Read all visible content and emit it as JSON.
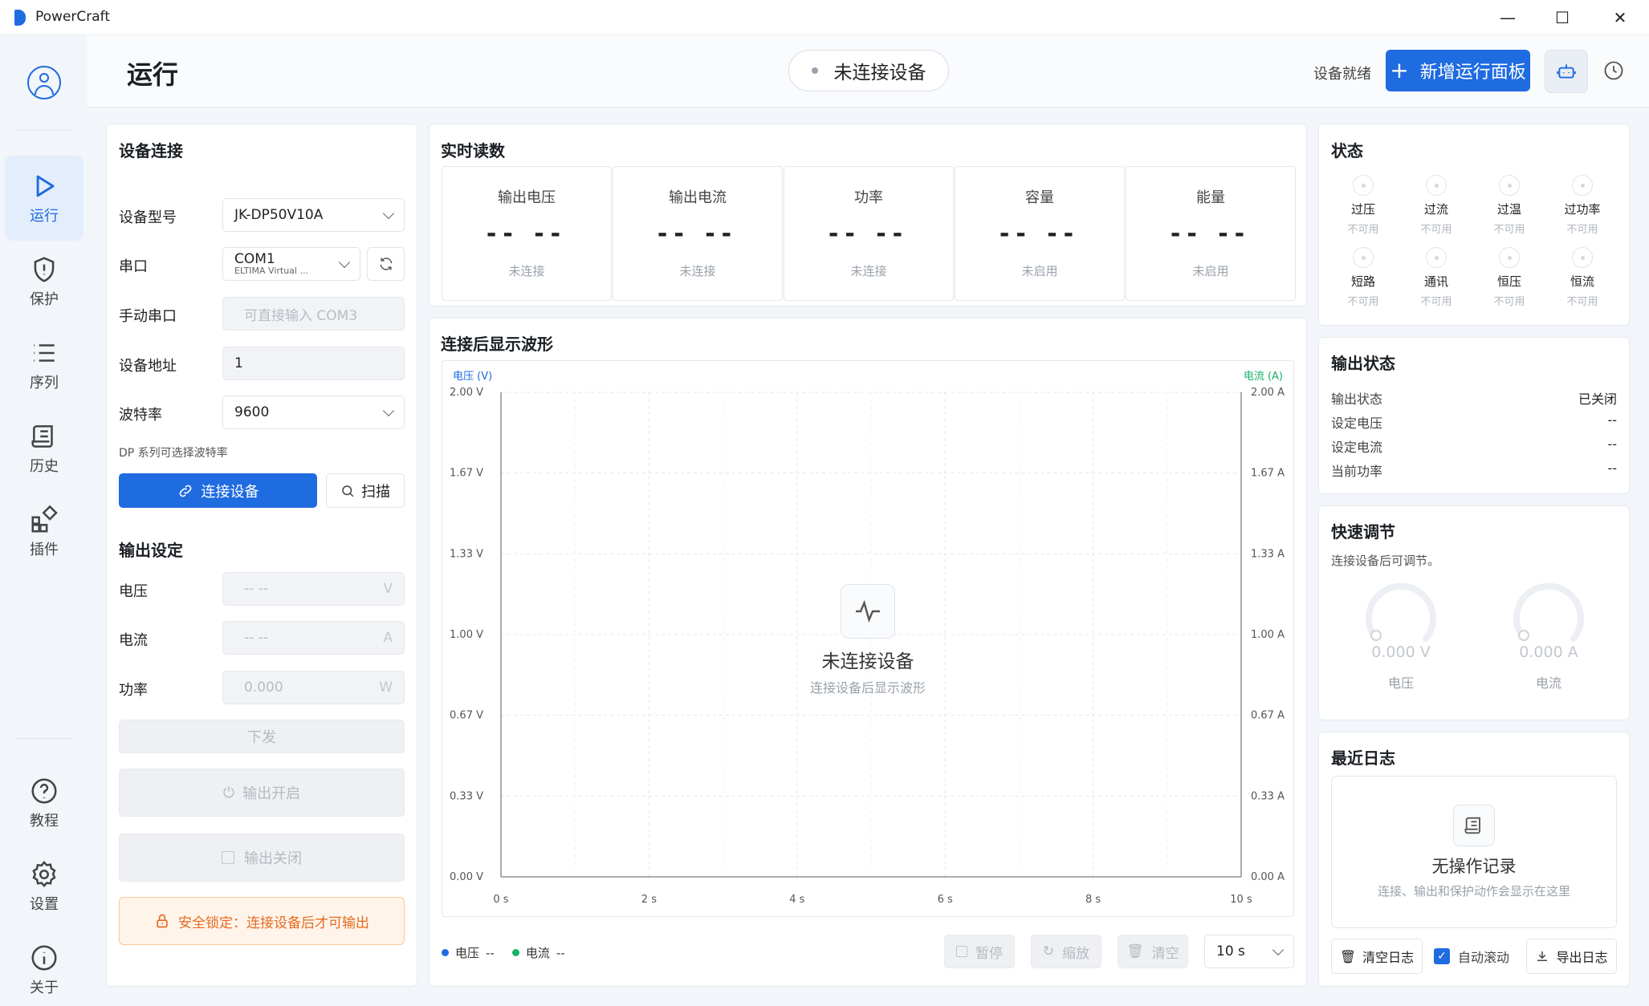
{
  "app": {
    "name": "PowerCraft"
  },
  "window": {
    "minimize": "—",
    "maximize": "☐",
    "close": "✕"
  },
  "nav": [
    {
      "label": "运行",
      "icon": "play-icon",
      "active": true
    },
    {
      "label": "保护",
      "icon": "shield-icon"
    },
    {
      "label": "序列",
      "icon": "list-icon"
    },
    {
      "label": "历史",
      "icon": "scroll-icon"
    },
    {
      "label": "插件",
      "icon": "plugin-icon"
    },
    {
      "label": "教程",
      "icon": "help-icon"
    },
    {
      "label": "设置",
      "icon": "gear-icon"
    },
    {
      "label": "关于",
      "icon": "info-icon"
    }
  ],
  "header": {
    "title": "运行",
    "status_pill": "未连接设备",
    "ready": "设备就绪",
    "new_panel": "新增运行面板"
  },
  "connection": {
    "title": "设备连接",
    "model_label": "设备型号",
    "model_value": "JK-DP50V10A",
    "port_label": "串口",
    "port_value": "COM1",
    "port_sub": "ELTIMA Virtual ...",
    "manual_label": "手动串口",
    "manual_placeholder": "可直接输入 COM3",
    "addr_label": "设备地址",
    "addr_value": "1",
    "baud_label": "波特率",
    "baud_value": "9600",
    "hint": "DP 系列可选择波特率",
    "connect": "连接设备",
    "scan": "扫描"
  },
  "output_set": {
    "title": "输出设定",
    "voltage_label": "电压",
    "voltage_value": "-- --",
    "voltage_unit": "V",
    "current_label": "电流",
    "current_value": "-- --",
    "current_unit": "A",
    "power_label": "功率",
    "power_value": "0.000",
    "power_unit": "W",
    "send": "下发",
    "on": "输出开启",
    "off": "输出关闭",
    "lock": "安全锁定：连接设备后才可输出"
  },
  "realtime": {
    "title": "实时读数",
    "items": [
      {
        "label": "输出电压",
        "value": "-- --",
        "sub": "未连接"
      },
      {
        "label": "输出电流",
        "value": "-- --",
        "sub": "未连接"
      },
      {
        "label": "功率",
        "value": "-- --",
        "sub": "未连接"
      },
      {
        "label": "容量",
        "value": "-- --",
        "sub": "未启用"
      },
      {
        "label": "能量",
        "value": "-- --",
        "sub": "未启用"
      }
    ]
  },
  "wave": {
    "title": "连接后显示波形",
    "left_axis": "电压 (V)",
    "right_axis": "电流 (A)",
    "left_ticks": [
      "2.00 V",
      "1.67 V",
      "1.33 V",
      "1.00 V",
      "0.67 V",
      "0.33 V",
      "0.00 V"
    ],
    "right_ticks": [
      "2.00 A",
      "1.67 A",
      "1.33 A",
      "1.00 A",
      "0.67 A",
      "0.33 A",
      "0.00 A"
    ],
    "x_ticks": [
      "0 s",
      "2 s",
      "4 s",
      "6 s",
      "8 s",
      "10 s"
    ],
    "empty_title": "未连接设备",
    "empty_sub": "连接设备后显示波形",
    "legend_v": "电压",
    "legend_v_val": "--",
    "legend_i": "电流",
    "legend_i_val": "--",
    "pause": "暂停",
    "zoom": "缩放",
    "clear": "清空",
    "range": "10 s",
    "color_v": "#1f6be0",
    "color_i": "#17b26a"
  },
  "status": {
    "title": "状态",
    "items": [
      {
        "name": "过压",
        "sub": "不可用"
      },
      {
        "name": "过流",
        "sub": "不可用"
      },
      {
        "name": "过温",
        "sub": "不可用"
      },
      {
        "name": "过功率",
        "sub": "不可用"
      },
      {
        "name": "短路",
        "sub": "不可用"
      },
      {
        "name": "通讯",
        "sub": "不可用"
      },
      {
        "name": "恒压",
        "sub": "不可用"
      },
      {
        "name": "恒流",
        "sub": "不可用"
      }
    ]
  },
  "output_status": {
    "title": "输出状态",
    "rows": [
      {
        "k": "输出状态",
        "v": "已关闭"
      },
      {
        "k": "设定电压",
        "v": "--"
      },
      {
        "k": "设定电流",
        "v": "--"
      },
      {
        "k": "当前功率",
        "v": "--"
      }
    ]
  },
  "quick": {
    "title": "快速调节",
    "hint": "连接设备后可调节。",
    "v_value": "0.000 V",
    "v_label": "电压",
    "i_value": "0.000 A",
    "i_label": "电流"
  },
  "log": {
    "title": "最近日志",
    "empty_title": "无操作记录",
    "empty_sub": "连接、输出和保护动作会显示在这里",
    "clear": "清空日志",
    "autoscroll": "自动滚动",
    "export": "导出日志"
  }
}
